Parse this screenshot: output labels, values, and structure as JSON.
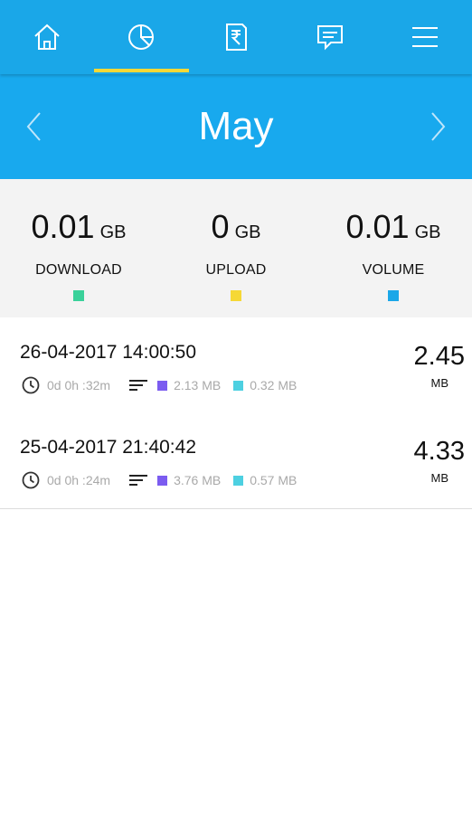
{
  "nav": {
    "items": [
      {
        "icon": "home-icon"
      },
      {
        "icon": "pie-chart-icon"
      },
      {
        "icon": "rupee-bill-icon"
      },
      {
        "icon": "chat-icon"
      },
      {
        "icon": "menu-icon"
      }
    ],
    "active_index": 1,
    "colors": {
      "bar": "#1aa7e8",
      "underline": "#f6d836"
    }
  },
  "month": {
    "title": "May",
    "prev_icon": "chevron-left-icon",
    "next_icon": "chevron-right-icon"
  },
  "summary": {
    "download": {
      "value": "0.01",
      "unit": "GB",
      "label": "DOWNLOAD",
      "color": "#3ad19a"
    },
    "upload": {
      "value": "0",
      "unit": "GB",
      "label": "UPLOAD",
      "color": "#f6d836"
    },
    "volume": {
      "value": "0.01",
      "unit": "GB",
      "label": "VOLUME",
      "color": "#1aa7e8"
    }
  },
  "sessions": [
    {
      "datetime": "26-04-2017 14:00:50",
      "duration": "0d 0h :32m",
      "download": "2.13 MB",
      "upload": "0.32 MB",
      "size": "2.45",
      "size_unit": "MB"
    },
    {
      "datetime": "25-04-2017 21:40:42",
      "duration": "0d 0h :24m",
      "download": "3.76 MB",
      "upload": "0.57 MB",
      "size": "4.33",
      "size_unit": "MB"
    }
  ],
  "legend_colors": {
    "download": "#7b5cf0",
    "upload": "#4dd0e1"
  }
}
